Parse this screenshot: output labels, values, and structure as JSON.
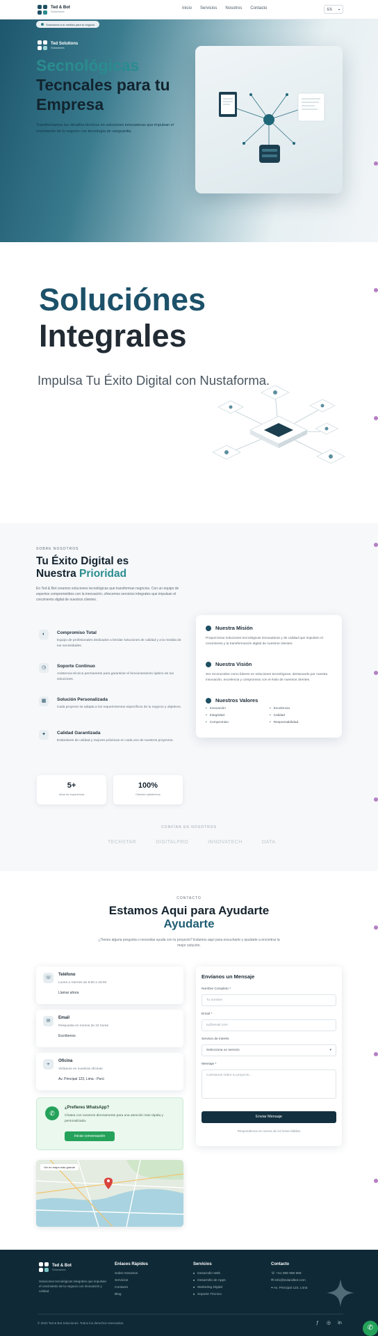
{
  "nav": {
    "brand_name": "Ted & Bot",
    "brand_sub": "Soluciones",
    "links": [
      "Inicio",
      "Servicios",
      "Nosotros",
      "Contacto"
    ],
    "lang": "ES"
  },
  "hero": {
    "pill": "Soluciones a tu medida para tu negocio",
    "brand_name": "Ted Solutions",
    "brand_sub": "Soluciones",
    "title_line1": "Secnológicas",
    "title_line2": "Tecncales para tu",
    "title_line3": "Empresa",
    "description": "Transformamos tus desafíos técnicos en soluciones innovadoras que impulsan el crecimiento de tu negocio con tecnología de vanguardia."
  },
  "solutions": {
    "title_line1": "Soluciónes",
    "title_line2": "Integrales",
    "subtitle": "Impulsa Tu Éxito Digital con Nustaforma."
  },
  "success": {
    "eyebrow": "SOBRE NOSOTROS",
    "title_line1": "Tu Éxito Digital es",
    "title_line2_a": "Nuestra ",
    "title_line2_b": "Prioridad",
    "description": "En Ted & Bot creamos soluciones tecnológicas que transforman negocios. Con un equipo de expertos comprometidos con la innovación, ofrecemos servicios integrales que impulsan el crecimiento digital de nuestros clientes.",
    "features": [
      {
        "icon": "◐",
        "title": "Compromiso Total",
        "desc": "Equipo de profesionales dedicados a brindar soluciones de calidad y a la medida de tus necesidades."
      },
      {
        "icon": "◷",
        "title": "Soporte Continuo",
        "desc": "Asistencia técnica permanente para garantizar el funcionamiento óptimo de tus soluciones."
      },
      {
        "icon": "▦",
        "title": "Solución Personalizada",
        "desc": "Cada proyecto se adapta a los requerimientos específicos de tu negocio y objetivos."
      },
      {
        "icon": "✦",
        "title": "Calidad Garantizada",
        "desc": "Estándares de calidad y mejores prácticas en cada uno de nuestros proyectos."
      }
    ],
    "mission_title": "Nuestra Misión",
    "mission_text": "Proporcionar soluciones tecnológicas innovadoras y de calidad que impulsen el crecimiento y la transformación digital de nuestros clientes.",
    "vision_title": "Nuestra Visión",
    "vision_text": "Ser reconocidos como líderes en soluciones tecnológicas, destacando por nuestra innovación, excelencia y compromiso con el éxito de nuestros clientes.",
    "values_title": "Nuestros Valores",
    "values": [
      "Innovación",
      "Excelencia",
      "Integridad",
      "Calidad",
      "Compromiso",
      "Responsabilidad"
    ],
    "stats": [
      {
        "number": "5+",
        "label": "Años de experiencia"
      },
      {
        "number": "100%",
        "label": "Clientes satisfechos"
      }
    ],
    "trust_label": "CONFÍAN EN NOSOTROS",
    "brands": [
      "TECHSTAR",
      "DIGITALPRO",
      "INNOVATECH",
      "DATA"
    ]
  },
  "contact": {
    "eyebrow": "CONTACTO",
    "title": "Estamos Aqui para Ayudarte",
    "title_accent": "Ayudarte",
    "description": "¿Tienes alguna pregunta o necesitas ayuda con tu proyecto? Estamos aquí para escucharte y ayudarte a encontrar la mejor solución.",
    "cards": [
      {
        "icon": "☏",
        "title": "Teléfono",
        "desc": "Lunes a Viernes de 9:00 a 18:00",
        "value": "Llamar ahora"
      },
      {
        "icon": "✉",
        "title": "Email",
        "desc": "Respuesta en menos de 24 horas",
        "value": "Escribenos"
      },
      {
        "icon": "⌖",
        "title": "Oficina",
        "desc": "Visítanos en nuestras oficinas",
        "value": "Av. Principal 123, Lima - Perú"
      }
    ],
    "whatsapp_title": "¿Prefieres WhatsApp?",
    "whatsapp_desc": "Chatea con nosotros directamente para una atención más rápida y personalizada.",
    "whatsapp_button": "Iniciar conversación",
    "map_tag": "Ver en mapa más grande",
    "form_title": "Envíanos un Mensaje",
    "name_label": "Nombre Completo *",
    "name_placeholder": "Tu nombre",
    "email_label": "Email *",
    "email_placeholder": "tu@email.com",
    "service_label": "Servicio de interés",
    "service_value": "Selecciona un servicio",
    "message_label": "Mensaje *",
    "message_placeholder": "Cuéntanos sobre tu proyecto...",
    "submit_label": "Enviar Mensaje",
    "form_note": "Respondemos en menos de 24 horas hábiles"
  },
  "footer": {
    "brand_name": "Ted & Bot",
    "brand_sub": "Soluciones",
    "description": "Soluciones tecnológicas integrales que impulsan el crecimiento de tu negocio con innovación y calidad.",
    "col1_title": "Enlaces Rápidos",
    "col1_items": [
      "Sobre Nosotros",
      "Servicios",
      "Contacto",
      "Blog"
    ],
    "col2_title": "Servicios",
    "col2_items": [
      "Desarrollo Web",
      "Desarrollo de Apps",
      "Marketing Digital",
      "Soporte Técnico"
    ],
    "col3_title": "Contacto",
    "col3_items": [
      "+51 999 999 999",
      "info@tedandbot.com",
      "Av. Principal 123, Lima"
    ],
    "copyright": "© 2024 Ted & Bot Soluciones. Todos los derechos reservados."
  },
  "colors": {
    "brand_dark": "#1f4f63",
    "accent_teal": "#2a8c8e",
    "whatsapp_green": "#25a25a",
    "footer_bg": "#0f2a36"
  }
}
